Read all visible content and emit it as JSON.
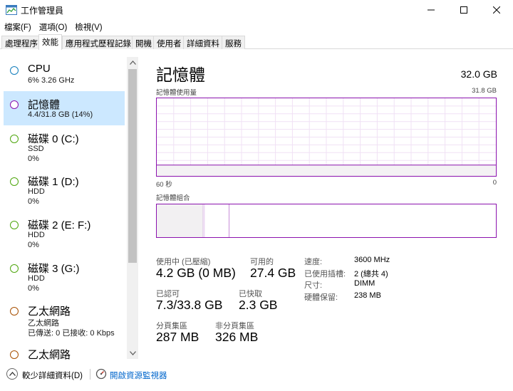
{
  "window": {
    "title": "工作管理員",
    "icon": "task-manager-icon"
  },
  "menu": [
    "檔案(F)",
    "選項(O)",
    "檢視(V)"
  ],
  "tabs": [
    "處理程序",
    "效能",
    "應用程式歷程記錄",
    "開機",
    "使用者",
    "詳細資料",
    "服務"
  ],
  "active_tab": "效能",
  "sidebar": {
    "items": [
      {
        "name": "CPU",
        "line1": "6%  3.26 GHz",
        "line2": "",
        "circle_color": "#117dbb"
      },
      {
        "name": "記憶體",
        "line1": "4.4/31.8 GB (14%)",
        "line2": "",
        "circle_color": "#8b12ae"
      },
      {
        "name": "磁碟 0 (C:)",
        "line1": "SSD",
        "line2": "0%",
        "circle_color": "#4da60c"
      },
      {
        "name": "磁碟 1 (D:)",
        "line1": "HDD",
        "line2": "0%",
        "circle_color": "#4da60c"
      },
      {
        "name": "磁碟 2 (E: F:)",
        "line1": "HDD",
        "line2": "0%",
        "circle_color": "#4da60c"
      },
      {
        "name": "磁碟 3 (G:)",
        "line1": "HDD",
        "line2": "0%",
        "circle_color": "#4da60c"
      },
      {
        "name": "乙太網路",
        "line1": "乙太網路",
        "line2": "已傳送: 0  已接收: 0 Kbps",
        "circle_color": "#a74f01"
      },
      {
        "name": "乙太網路",
        "line1": "",
        "line2": "",
        "circle_color": "#a74f01"
      }
    ]
  },
  "memory": {
    "title": "記憶體",
    "total": "32.0 GB",
    "usage_label": "記憶體使用量",
    "usage_max": "31.8 GB",
    "time_left": "60 秒",
    "time_right": "0",
    "usage_fraction": 0.14,
    "composition_label": "記憶體組合",
    "composition": {
      "in_use_fraction": 0.137,
      "modified_fraction": 0.004,
      "standby_fraction": 0.072
    },
    "stats": {
      "in_use_label": "使用中 (已壓縮)",
      "in_use_value": "4.2 GB (0 MB)",
      "available_label": "可用的",
      "available_value": "27.4 GB",
      "committed_label": "已認可",
      "committed_value": "7.3/33.8 GB",
      "cached_label": "已快取",
      "cached_value": "2.3 GB",
      "paged_label": "分頁集區",
      "paged_value": "287 MB",
      "nonpaged_label": "非分頁集區",
      "nonpaged_value": "326 MB"
    },
    "specs": [
      {
        "label": "速度:",
        "value": "3600 MHz"
      },
      {
        "label": "已使用插槽:",
        "value": "2 (總共 4)"
      },
      {
        "label": "尺寸:",
        "value": "DIMM"
      },
      {
        "label": "硬體保留:",
        "value": "238 MB"
      }
    ],
    "accent": "#8b12ae"
  },
  "footer": {
    "fewer_details": "較少詳細資料(D)",
    "resource_monitor": "開啟資源監視器"
  }
}
